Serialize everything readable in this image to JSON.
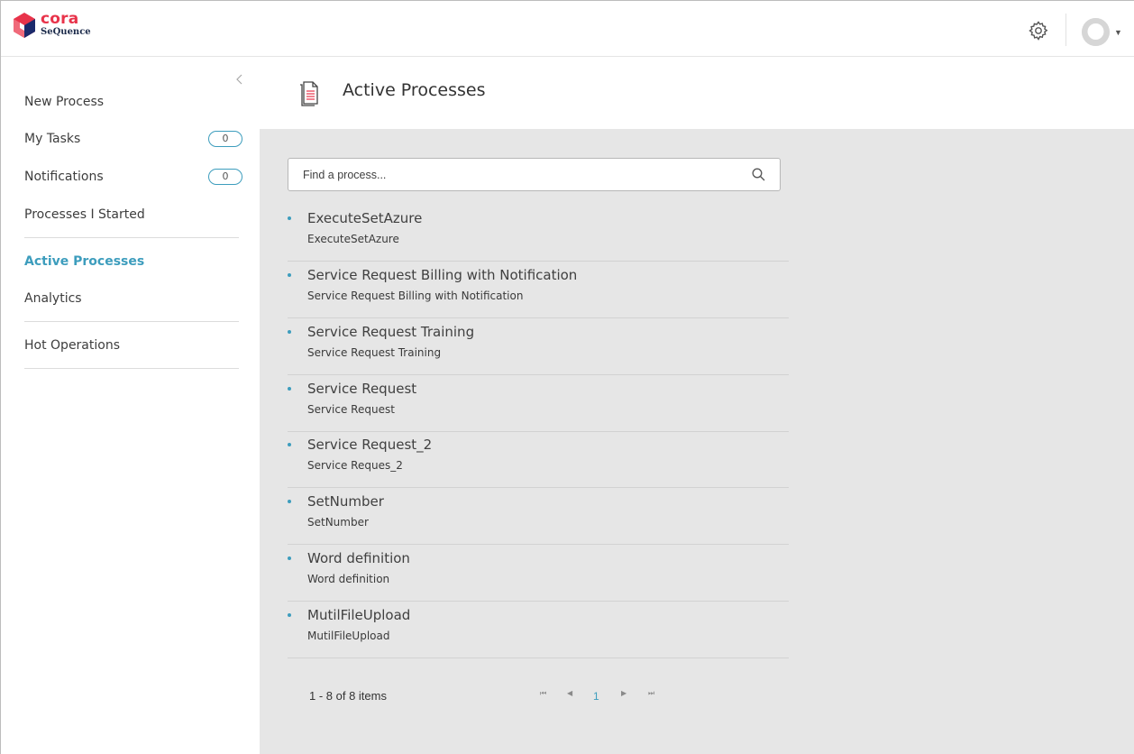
{
  "brand": {
    "name": "cora",
    "subname": "SeQuence"
  },
  "header": {
    "settings_icon": "gear-icon",
    "avatar_icon": "user-avatar-icon",
    "menu_caret": "▼"
  },
  "sidebar": {
    "collapse_icon": "chevron-left-icon",
    "items": [
      {
        "label": "New Process"
      },
      {
        "label": "My Tasks",
        "badge": "0"
      },
      {
        "label": "Notifications",
        "badge": "0"
      },
      {
        "label": "Processes I Started"
      },
      {
        "label": "Active Processes",
        "active": true
      },
      {
        "label": "Analytics"
      },
      {
        "label": "Hot Operations"
      }
    ]
  },
  "page": {
    "title": "Active Processes",
    "title_icon": "document-icon"
  },
  "search": {
    "placeholder": "Find a process...",
    "value": ""
  },
  "processes": [
    {
      "name": "ExecuteSetAzure",
      "description": "ExecuteSetAzure"
    },
    {
      "name": "Service Request Billing with Notification",
      "description": "Service Request Billing with Notification"
    },
    {
      "name": "Service Request Training",
      "description": "Service Request Training"
    },
    {
      "name": "Service Request",
      "description": "Service Request"
    },
    {
      "name": "Service Request_2",
      "description": "Service Reques_2"
    },
    {
      "name": "SetNumber",
      "description": "SetNumber"
    },
    {
      "name": "Word definition",
      "description": "Word definition"
    },
    {
      "name": "MutilFileUpload",
      "description": "MutilFileUpload"
    }
  ],
  "pagination": {
    "summary": "1 - 8 of 8 items",
    "current_page": "1",
    "first": "⏮",
    "prev": "◀",
    "next": "▶",
    "last": "⏭"
  },
  "colors": {
    "accent": "#3d9dbd",
    "brand_red": "#e8334a",
    "content_bg": "#e6e6e6"
  }
}
